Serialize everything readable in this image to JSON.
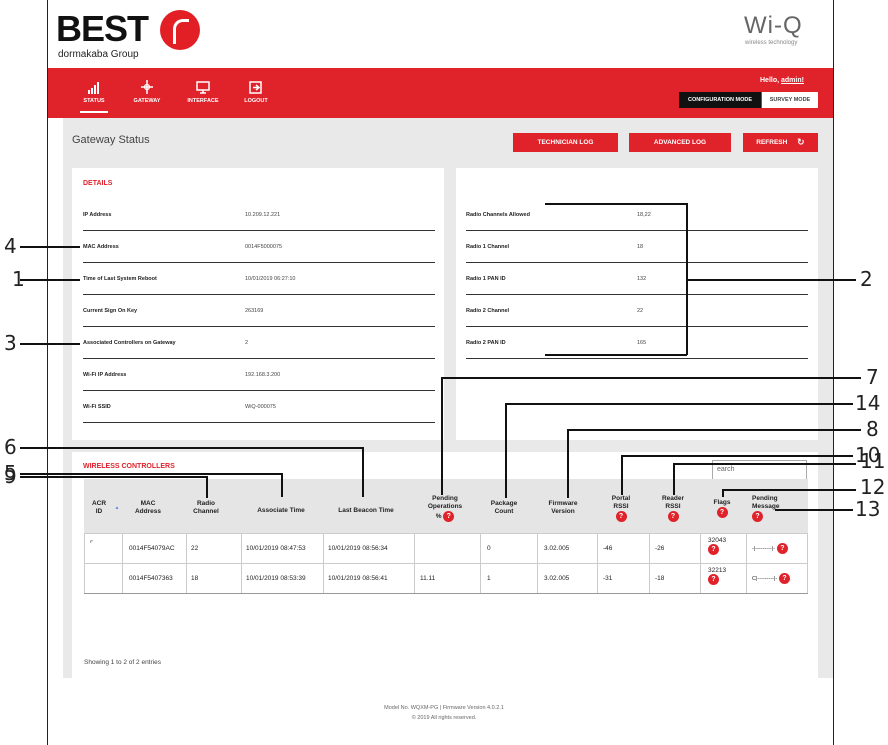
{
  "header": {
    "logo_text": "BEST",
    "logo_sub": "dormakaba Group",
    "brand": "Wi-Q",
    "brand_sub": "wireless technology"
  },
  "nav": {
    "items": [
      {
        "label": "STATUS",
        "icon": "signal-bars-icon"
      },
      {
        "label": "GATEWAY",
        "icon": "gateway-icon"
      },
      {
        "label": "INTERFACE",
        "icon": "monitor-icon"
      },
      {
        "label": "LOGOUT",
        "icon": "logout-icon"
      }
    ],
    "hello_prefix": "Hello, ",
    "username": "admin!",
    "config_mode": "CONFIGURATION MODE",
    "survey_mode": "SURVEY MODE"
  },
  "page": {
    "title": "Gateway Status",
    "tech_log": "TECHNICIAN LOG",
    "advanced_log": "ADVANCED LOG",
    "refresh": "REFRESH"
  },
  "details": {
    "title": "DETAILS",
    "rows": [
      {
        "label": "IP Address",
        "value": "10.209.12.221"
      },
      {
        "label": "MAC Address",
        "value": "0014F5000075"
      },
      {
        "label": "Time of Last System Reboot",
        "value": "10/01/2019 06:27:10"
      },
      {
        "label": "Current Sign On Key",
        "value": "263169"
      },
      {
        "label": "Associated Controllers on Gateway",
        "value": "2"
      },
      {
        "label": "Wi-Fi IP Address",
        "value": "192.168.3.200"
      },
      {
        "label": "Wi-Fi SSID",
        "value": "WiQ-000075"
      }
    ]
  },
  "radio": {
    "rows": [
      {
        "label": "Radio Channels Allowed",
        "value": "18,22"
      },
      {
        "label": "Radio 1 Channel",
        "value": "18"
      },
      {
        "label": "Radio 1 PAN ID",
        "value": "132"
      },
      {
        "label": "Radio 2 Channel",
        "value": "22"
      },
      {
        "label": "Radio 2 PAN ID",
        "value": "165"
      }
    ]
  },
  "wireless": {
    "title": "WIRELESS CONTROLLERS",
    "search_placeholder": "earch",
    "headers": {
      "acr_id": [
        "ACR",
        "ID"
      ],
      "mac": [
        "MAC",
        "Address"
      ],
      "radio": [
        "Radio",
        "Channel"
      ],
      "assoc": [
        "Associate Time"
      ],
      "beacon": [
        "Last Beacon Time"
      ],
      "pending_ops": [
        "Pending",
        "Operations",
        "%"
      ],
      "package": [
        "Package",
        "Count"
      ],
      "firmware": [
        "Firmware",
        "Version"
      ],
      "portal": [
        "Portal",
        "RSSI"
      ],
      "reader": [
        "Reader",
        "RSSI"
      ],
      "flags": [
        "Flags"
      ],
      "pending_msg": [
        "Pending",
        "Message"
      ]
    },
    "rows": [
      {
        "acr_id": "⌜",
        "mac": "0014F54079AC",
        "radio": "22",
        "assoc": "10/01/2019 08:47:53",
        "beacon": "10/01/2019 08:56:34",
        "pending_ops": "",
        "package": "0",
        "firmware": "3.02.005",
        "portal": "-46",
        "reader": "-26",
        "flags": "32043",
        "pending_msg": "-|---------|-"
      },
      {
        "acr_id": "",
        "mac": "0014F5407363",
        "radio": "18",
        "assoc": "10/01/2019 08:53:39",
        "beacon": "10/01/2019 08:56:41",
        "pending_ops": "11.11",
        "package": "1",
        "firmware": "3.02.005",
        "portal": "-31",
        "reader": "-18",
        "flags": "32213",
        "pending_msg": "C|---------|-"
      }
    ],
    "showing": "Showing 1 to 2 of 2 entries",
    "sort_indicator": "▲",
    "help_glyph": "?"
  },
  "footer": {
    "line1": "Model No. WQXM-PG   |   Firmware Version 4.0.2.1",
    "line2": "© 2019 All rights reserved."
  },
  "callouts": [
    "1",
    "2",
    "3",
    "4",
    "5",
    "6",
    "7",
    "8",
    "9",
    "10",
    "11",
    "12",
    "13",
    "14"
  ],
  "colors": {
    "accent": "#e0222b",
    "background": "#e9e9e9",
    "panel": "#ffffff"
  }
}
